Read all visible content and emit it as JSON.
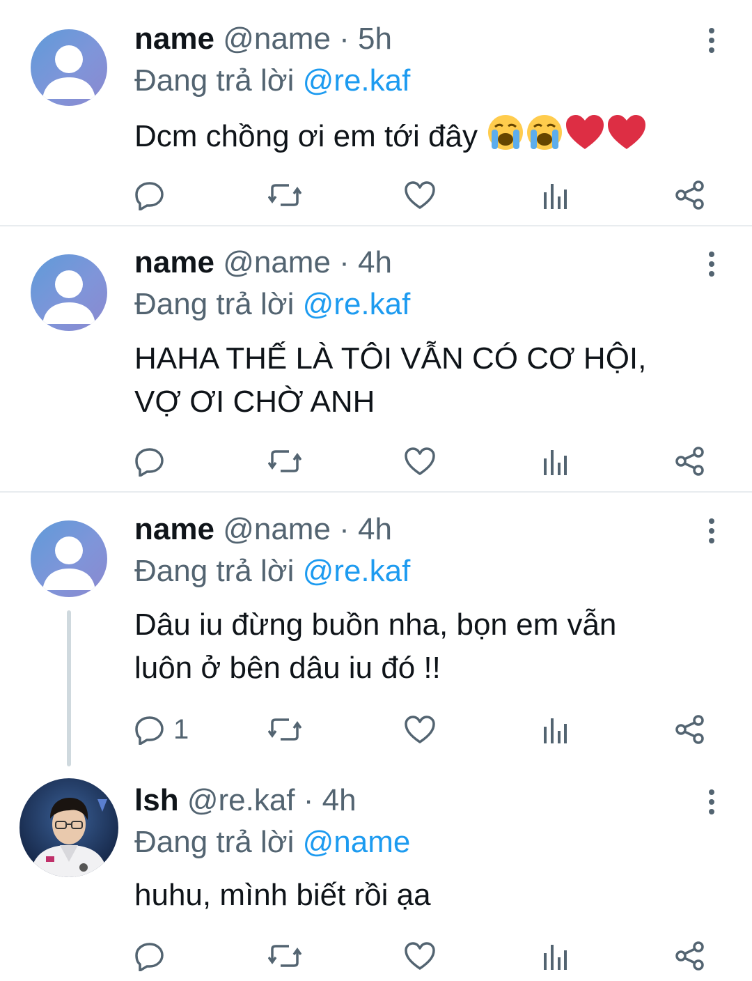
{
  "tweets": [
    {
      "name": "name",
      "handle": "@name",
      "separator": "·",
      "time": "5h",
      "replying_prefix": "Đang trả lời",
      "replying_to": "@re.kaf",
      "text": "Dcm chồng ơi em tới đây",
      "emojis": [
        "loudly-crying-face",
        "loudly-crying-face",
        "red-heart",
        "red-heart"
      ],
      "reply_count": ""
    },
    {
      "name": "name",
      "handle": "@name",
      "separator": "·",
      "time": "4h",
      "replying_prefix": "Đang trả lời",
      "replying_to": "@re.kaf",
      "text_line1": "HAHA THẾ LÀ TÔI VẪN CÓ CƠ HỘI,",
      "text_line2": "VỢ ƠI CHỜ ANH",
      "reply_count": ""
    },
    {
      "name": "name",
      "handle": "@name",
      "separator": "·",
      "time": "4h",
      "replying_prefix": "Đang trả lời",
      "replying_to": "@re.kaf",
      "text_line1": "Dâu iu đừng buồn nha, bọn em vẫn",
      "text_line2": "luôn ở bên dâu iu đó  !!",
      "reply_count": "1"
    },
    {
      "name": "lsh",
      "handle": "@re.kaf",
      "separator": "·",
      "time": "4h",
      "replying_prefix": "Đang trả lời",
      "replying_to": "@name",
      "text": "huhu, mình biết rồi ạa",
      "reply_count": ""
    }
  ],
  "icons": {
    "reply": "reply-icon",
    "retweet": "retweet-icon",
    "like": "heart-icon",
    "views": "views-icon",
    "share": "share-icon",
    "more": "more-vertical-icon"
  },
  "colors": {
    "text": "#0f1419",
    "secondary": "#536471",
    "mention": "#1d9bf0",
    "divider": "#e8ecef",
    "thread_line": "#cfd9de",
    "heart_emoji": "#dd2e44"
  }
}
